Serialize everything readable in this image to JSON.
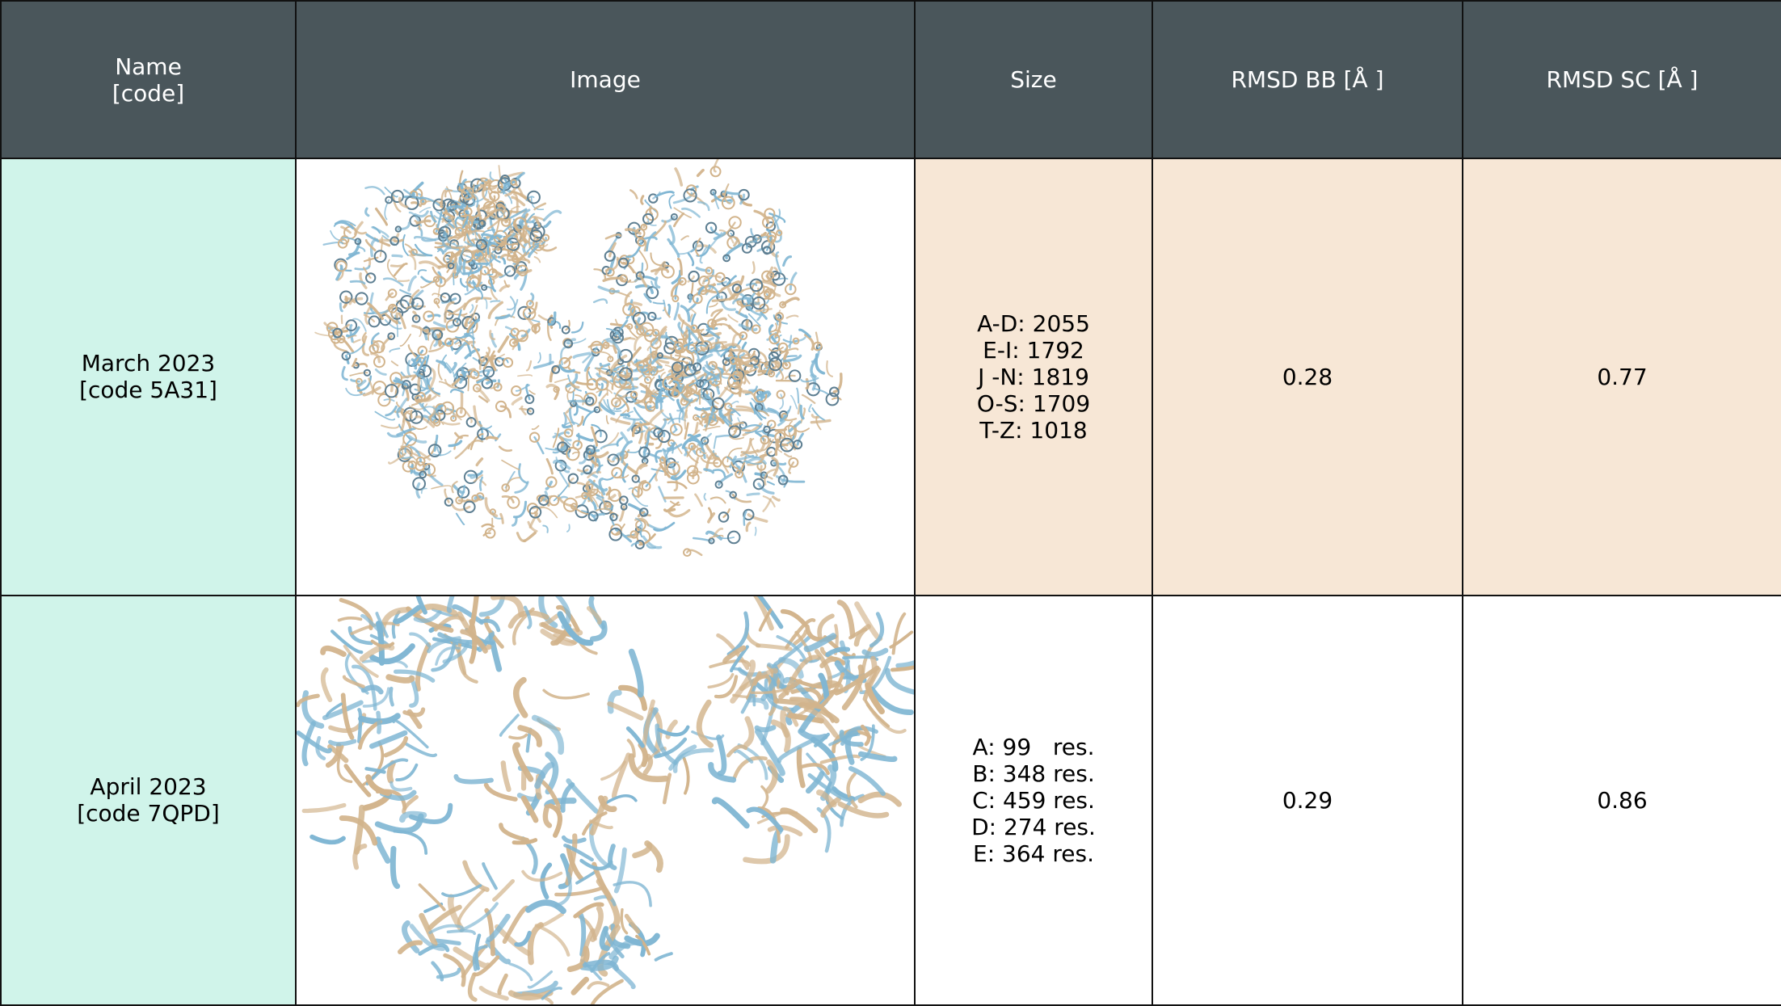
{
  "header": {
    "name_line1": "Name",
    "name_line2": "[code]",
    "image": "Image",
    "size": "Size",
    "rmsd_bb": "RMSD BB  [Å ]",
    "rmsd_sc": "RMSD SC  [Å ]"
  },
  "rows": [
    {
      "name": "March 2023",
      "code": "[code 5A31]",
      "image_icon": "protein-structure-image",
      "size": [
        "A-D: 2055",
        "E-I: 1792",
        "J -N: 1819",
        "O-S: 1709",
        "T-Z: 1018"
      ],
      "rmsd_bb": "0.28",
      "rmsd_sc": "0.77"
    },
    {
      "name": "April 2023",
      "code": "[code 7QPD]",
      "image_icon": "protein-structure-image",
      "size": [
        "A: 99   res.",
        "B: 348 res.",
        "C: 459 res.",
        "D: 274 res.",
        "E: 364 res."
      ],
      "rmsd_bb": "0.29",
      "rmsd_sc": "0.86"
    }
  ],
  "colors": {
    "header_bg": "#4a565b",
    "name_cell_bg": "#d0f4ea",
    "highlight_row_bg": "#f7e7d6",
    "ribbon_blue": "#7fb6d3",
    "ribbon_tan": "#d2b48c"
  }
}
